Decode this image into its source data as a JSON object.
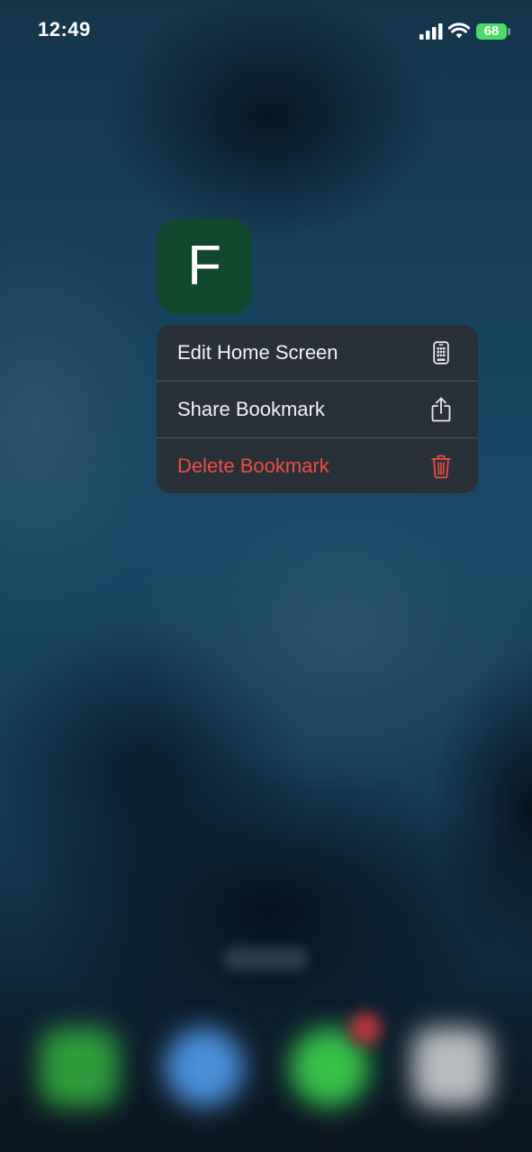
{
  "status_bar": {
    "time": "12:49",
    "battery_level": "68",
    "signal_icon": "cellular-signal-icon",
    "wifi_icon": "wifi-icon",
    "battery_icon": "battery-charging-icon"
  },
  "app": {
    "icon_letter": "F",
    "icon_color": "#11482e"
  },
  "context_menu": {
    "items": [
      {
        "label": "Edit Home Screen",
        "icon": "phone-grid-icon"
      },
      {
        "label": "Share Bookmark",
        "icon": "share-icon"
      },
      {
        "label": "Delete Bookmark",
        "icon": "trash-icon",
        "color": "#ee4d45"
      }
    ]
  },
  "dock": {
    "apps": [
      {
        "icon": "phone-app-icon",
        "color": "#2f9c3c"
      },
      {
        "icon": "safari-app-icon",
        "color": "#4a8fd8"
      },
      {
        "icon": "messages-app-icon",
        "color": "#37c24a"
      },
      {
        "icon": "camera-app-icon",
        "color": "#b9bcc0"
      }
    ]
  }
}
